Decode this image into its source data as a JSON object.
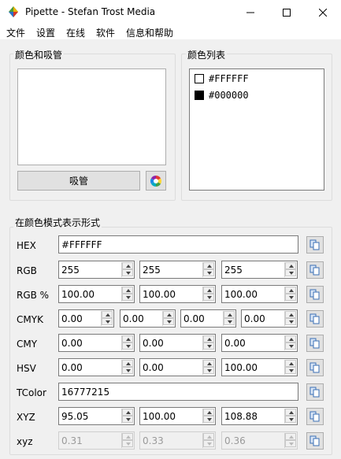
{
  "window": {
    "title": "Pipette - Stefan Trost Media"
  },
  "menu": [
    "文件",
    "设置",
    "在线",
    "软件",
    "信息和帮助"
  ],
  "picker_group": {
    "title": "颜色和吸管",
    "pipette_label": "吸管"
  },
  "list_group": {
    "title": "颜色列表",
    "items": [
      {
        "hex": "#FFFFFF",
        "color": "#FFFFFF"
      },
      {
        "hex": "#000000",
        "color": "#000000"
      }
    ]
  },
  "modes_group": {
    "title": "在颜色模式表示形式",
    "rows": [
      {
        "label": "HEX",
        "values": [
          "#FFFFFF"
        ]
      },
      {
        "label": "RGB",
        "values": [
          "255",
          "255",
          "255"
        ]
      },
      {
        "label": "RGB %",
        "values": [
          "100.00",
          "100.00",
          "100.00"
        ]
      },
      {
        "label": "CMYK",
        "values": [
          "0.00",
          "0.00",
          "0.00",
          "0.00"
        ]
      },
      {
        "label": "CMY",
        "values": [
          "0.00",
          "0.00",
          "0.00"
        ]
      },
      {
        "label": "HSV",
        "values": [
          "0.00",
          "0.00",
          "100.00"
        ]
      },
      {
        "label": "TColor",
        "values": [
          "16777215"
        ]
      },
      {
        "label": "XYZ",
        "values": [
          "95.05",
          "100.00",
          "108.88"
        ]
      },
      {
        "label": "xyz",
        "values": [
          "0.31",
          "0.33",
          "0.36"
        ]
      }
    ]
  }
}
